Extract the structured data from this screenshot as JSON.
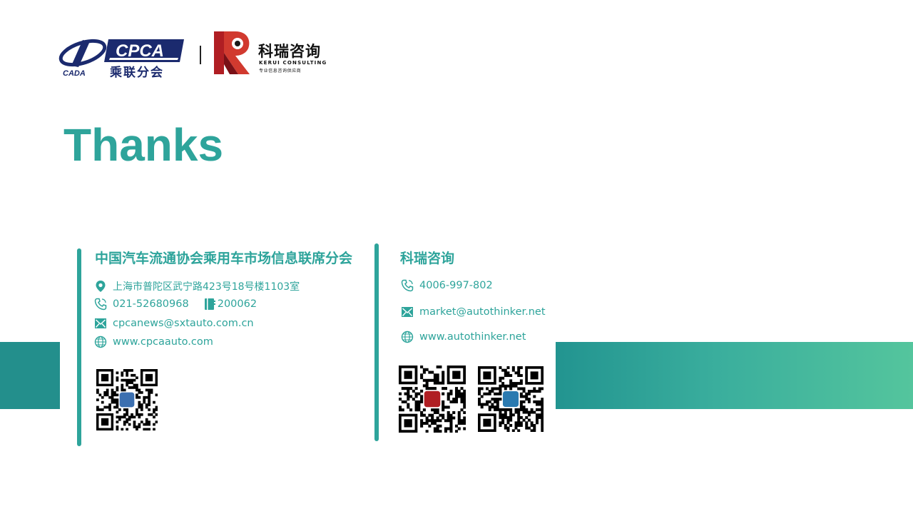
{
  "header": {
    "cpca_logo_text": "CPCA",
    "cpca_logo_cn": "乘联分会",
    "cada_logo_text": "CADA",
    "kerui_logo_cn": "科瑞咨询",
    "kerui_logo_en": "KERUI CONSULTING",
    "kerui_logo_slogan": "专业信息咨询供应商"
  },
  "title": "Thanks",
  "colors": {
    "accent": "#2ea49b",
    "band_dark": "#238f8c",
    "band_light": "#54c59d",
    "logo_navy": "#1b2a6e",
    "logo_red": "#b01e23"
  },
  "cpca_block": {
    "name": "中国汽车流通协会乘用车市场信息联席分会",
    "address": "上海市普陀区武宁路423号18号楼1103室",
    "phone": "021-52680968",
    "postcode": "200062",
    "email": "cpcanews@sxtauto.com.cn",
    "website": "www.cpcaauto.com",
    "icons": [
      "location-icon",
      "phone-icon",
      "postcode-icon",
      "email-icon",
      "globe-icon"
    ]
  },
  "kerui_block": {
    "name": "科瑞咨询",
    "phone": "4006-997-802",
    "email": "market@autothinker.net",
    "website": "www.autothinker.net",
    "icons": [
      "phone-icon",
      "email-icon",
      "globe-icon"
    ]
  },
  "qr_codes": [
    "cpca-qr-code",
    "kerui-qr-code",
    "autothinker-qr-code"
  ]
}
